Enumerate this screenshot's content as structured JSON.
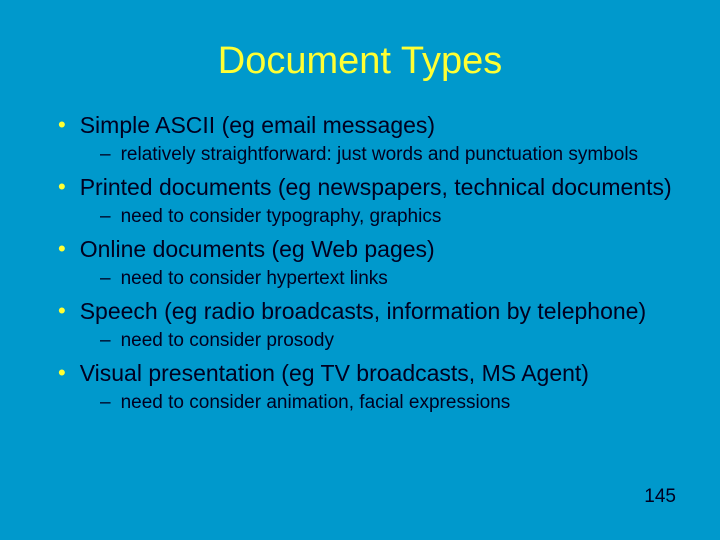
{
  "title": "Document Types",
  "bullets": [
    {
      "text": "Simple ASCII (eg email messages)",
      "sub": [
        "relatively straightforward: just words and punctuation symbols"
      ]
    },
    {
      "text": "Printed documents (eg newspapers, technical documents)",
      "sub": [
        "need to consider typography, graphics"
      ]
    },
    {
      "text": "Online documents (eg Web pages)",
      "sub": [
        "need to consider hypertext links"
      ]
    },
    {
      "text": "Speech (eg radio broadcasts, information by telephone)",
      "sub": [
        "need to consider prosody"
      ]
    },
    {
      "text": "Visual presentation (eg TV broadcasts, MS Agent)",
      "sub": [
        "need to consider animation, facial expressions"
      ]
    }
  ],
  "page_number": "145"
}
